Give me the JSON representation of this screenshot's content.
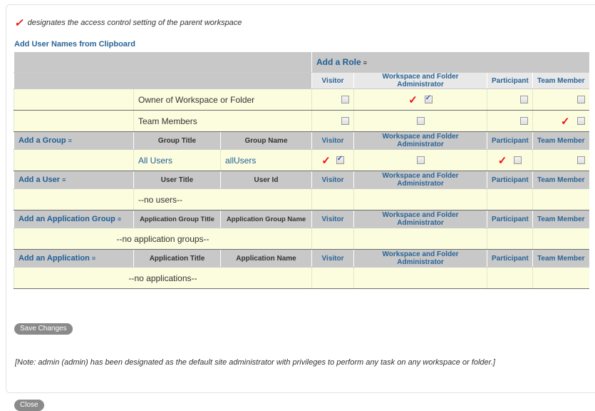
{
  "legend": {
    "check_glyph": "✓",
    "text": "designates the access control setting of the parent workspace"
  },
  "clipboard_link": "Add User Names from Clipboard",
  "add_role": "Add a Role",
  "filter_glyph": "≡",
  "roles": [
    "Visitor",
    "Workspace and Folder Administrator",
    "Participant",
    "Team Member"
  ],
  "owner_rows": [
    {
      "label": "Owner of Workspace or Folder",
      "visitor": false,
      "admin": true,
      "participant": false,
      "team": false,
      "parent": "admin"
    },
    {
      "label": "Team Members",
      "visitor": false,
      "admin": false,
      "participant": false,
      "team": false,
      "parent": "team"
    }
  ],
  "groups": {
    "header": "Add a Group",
    "col1": "Group Title",
    "col2": "Group Name",
    "rows": [
      {
        "title": "All Users",
        "name": "allUsers",
        "visitor": true,
        "admin": false,
        "participant": false,
        "team": false,
        "parents": [
          "visitor",
          "participant"
        ]
      }
    ]
  },
  "users": {
    "header": "Add a User",
    "col1": "User Title",
    "col2": "User Id",
    "empty": "--no users--"
  },
  "app_groups": {
    "header": "Add an Application Group",
    "col1": "Application Group Title",
    "col2": "Application Group Name",
    "empty": "--no application groups--"
  },
  "apps": {
    "header": "Add an Application",
    "col1": "Application Title",
    "col2": "Application Name",
    "empty": "--no applications--"
  },
  "save_button": "Save Changes",
  "note": "[Note: admin (admin) has been designated as the default site administrator with privileges to perform any task on any workspace or folder.]",
  "close_button": "Close",
  "colors": {
    "link": "#1f5e96",
    "check": "#e11111",
    "row_bg": "#fcfcdf",
    "header_bg": "#c8c8c8"
  }
}
